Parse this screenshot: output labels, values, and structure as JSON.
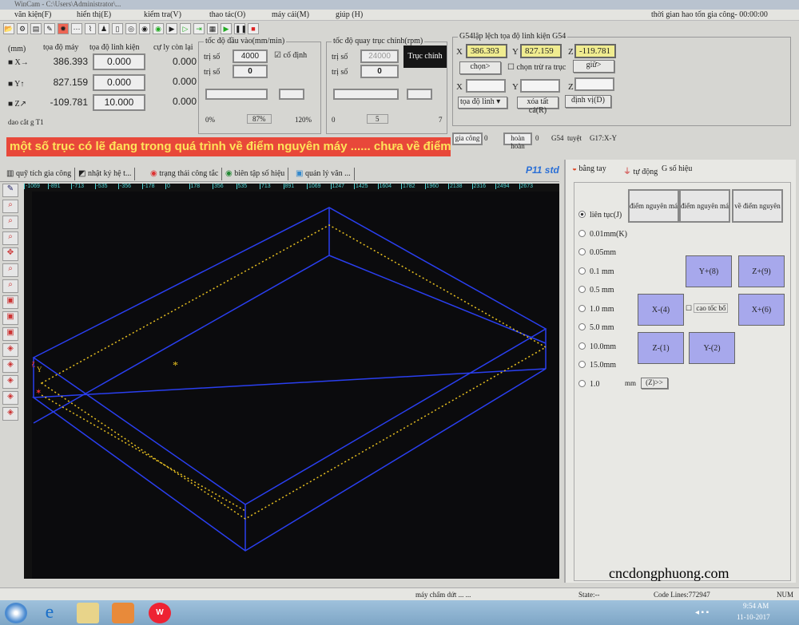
{
  "title": "WinCam - C:\\Users\\Administrator\\...",
  "menu": [
    "văn kiện(F)",
    "hiển thị(E)",
    "kiểm tra(V)",
    "thao tác(O)",
    "máy cái(M)",
    "giúp (H)"
  ],
  "machining_time": "thời gian hao tốn gia công- 00:00:00",
  "coords": {
    "headers": [
      "(mm)",
      "tọa độ máy",
      "tọa độ linh kiện",
      "cự ly còn lại"
    ],
    "axes": [
      {
        "name": "X→",
        "machine": "386.393",
        "work": "0.000",
        "remaining": "0.000"
      },
      {
        "name": "Y↑",
        "machine": "827.159",
        "work": "0.000",
        "remaining": "0.000"
      },
      {
        "name": "Z↗",
        "machine": "-109.781",
        "work": "10.000",
        "remaining": "0.000"
      }
    ],
    "tool": "dao cắt g T1"
  },
  "feed": {
    "title": "tốc độ đầu vào(mm/min)",
    "label1": "trị số",
    "value1": "4000",
    "fixed_label": "cố định",
    "fixed": true,
    "label2": "trị số",
    "value2": "0",
    "min": "0%",
    "current": "87%",
    "max": "120%"
  },
  "spindle": {
    "title": "tốc độ quay trục chính(rpm)",
    "label1": "trị số",
    "value1": "24000",
    "button": "Trục chính",
    "label2": "trị số",
    "value2": "0",
    "min": "0",
    "current": "5",
    "max": "7"
  },
  "offset": {
    "title": "G54lập lệch tọa độ linh kiện G54",
    "x": "386.393",
    "y": "827.159",
    "z": "-119.781",
    "choose_btn": "chọn>",
    "checkbox": "chọn trừ ra trục",
    "save_btn": "giữ>",
    "coord_select": "tọa độ linh",
    "clear_btn": "xóa tất cả(R)",
    "locate_btn": "định vị(D)",
    "axis_labels": [
      "X",
      "Y",
      "Z"
    ]
  },
  "statusfields": [
    "gia công",
    "0",
    "hoàn hoàn",
    "0",
    "G54",
    "tuyệt",
    "G17:X-Y"
  ],
  "banner": "một số trục có lẽ đang trong quá trình về điểm nguyên máy ...... chưa về điểm",
  "tabs": [
    "quỹ tích gia công",
    "nhật ký hệ t...",
    "trạng thái công tắc",
    "biên tập số hiệu",
    "quản lý văn ..."
  ],
  "p11": "P11 std",
  "ruler": [
    "-1069",
    "-891",
    "-713",
    "-535",
    "-356",
    "-178",
    "0",
    "178",
    "356",
    "535",
    "713",
    "891",
    "1069",
    "1247",
    "1425",
    "1604",
    "1782",
    "1960",
    "2138",
    "2316",
    "2494",
    "2673"
  ],
  "right_tabs": [
    "bằng tay",
    "tự động",
    "G  số hiệu"
  ],
  "home_buttons": [
    "điểm nguyên máy",
    "điểm nguyên máy",
    "về điểm nguyên"
  ],
  "steps": [
    "liên tục(J)",
    "0.01mm(K)",
    "0.05mm",
    "0.1 mm",
    "0.5 mm",
    "1.0 mm",
    "5.0 mm",
    "10.0mm",
    "15.0mm",
    "1.0"
  ],
  "step_unit": "mm",
  "step_btn": "(Z)>>",
  "jog": {
    "yplus": "Y+(8)",
    "zplus": "Z+(9)",
    "xminus": "X-(4)",
    "xplus": "X+(6)",
    "zminus": "Z-(1)",
    "yminus": "Y-(2)",
    "fast": "cao tốc bổ"
  },
  "watermark": "cncdongphuong.com",
  "status": {
    "msg": "máy chấm dứt ... ...",
    "state": "State:--",
    "lines": "Code Lines:772947",
    "num": "NUM"
  },
  "clock": {
    "time": "9:54 AM",
    "date": "11-10-2017"
  }
}
